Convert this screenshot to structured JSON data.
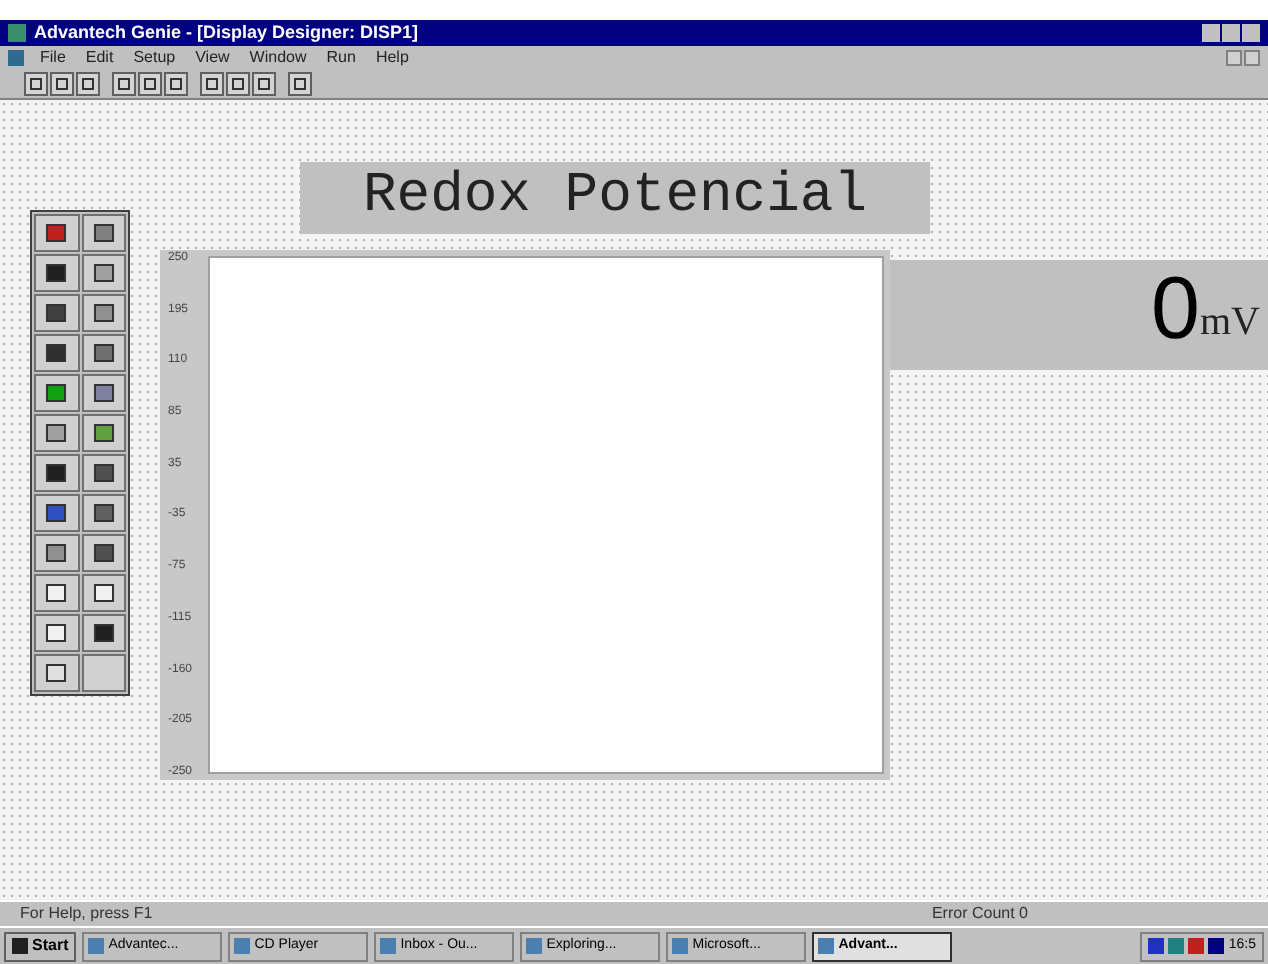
{
  "window": {
    "title": "Advantech Genie - [Display Designer: DISP1]"
  },
  "menu": [
    "File",
    "Edit",
    "Setup",
    "View",
    "Window",
    "Run",
    "Help"
  ],
  "display": {
    "title": "Redox Potencial",
    "value": "0",
    "unit": "mV",
    "axis_labels": [
      "250",
      "195",
      "110",
      "85",
      "35",
      "-35",
      "-75",
      "-115",
      "-160",
      "-205",
      "-250"
    ]
  },
  "status_bar": {
    "help": "For Help, press F1",
    "errors": "Error Count 0"
  },
  "taskbar": {
    "start": "Start",
    "tasks": [
      {
        "label": "Advantec...",
        "selected": false
      },
      {
        "label": "CD Player",
        "selected": false
      },
      {
        "label": "Inbox - Ou...",
        "selected": false
      },
      {
        "label": "Exploring...",
        "selected": false
      },
      {
        "label": "Microsoft...",
        "selected": false
      },
      {
        "label": "Advant...",
        "selected": true
      }
    ],
    "clock": "16:5"
  }
}
